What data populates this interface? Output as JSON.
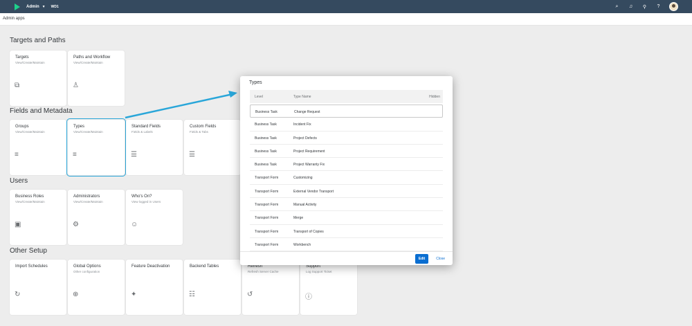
{
  "shell": {
    "app_name": "Admin",
    "system": "WD1",
    "icons": [
      "search-icon",
      "bell-icon",
      "filter-icon",
      "help-icon"
    ]
  },
  "subbar": {
    "label": "Admin apps"
  },
  "sections": {
    "targets": "Targets and Paths",
    "fields": "Fields and Metadata",
    "users": "Users",
    "other": "Other Setup"
  },
  "tiles": {
    "targets": {
      "title": "Targets",
      "sub": "View/Create/Maintain"
    },
    "paths": {
      "title": "Paths and Workflow",
      "sub": "View/Create/Maintain"
    },
    "groups": {
      "title": "Groups",
      "sub": "View/Create/Maintain"
    },
    "types": {
      "title": "Types",
      "sub": "View/Create/Maintain"
    },
    "standard_fields": {
      "title": "Standard Fields",
      "sub": "Fields & Labels"
    },
    "custom_fields": {
      "title": "Custom Fields",
      "sub": "Fields & Tabs"
    },
    "business_roles": {
      "title": "Business Roles",
      "sub": "View/Create/Maintain"
    },
    "administrators": {
      "title": "Administrators",
      "sub": "View/Create/Maintain"
    },
    "whos_on": {
      "title": "Who's On?",
      "sub": "View logged in Users"
    },
    "import_schedules": {
      "title": "Import Schedules",
      "sub": ""
    },
    "global_options": {
      "title": "Global Options",
      "sub": "Other configuration"
    },
    "feature_deactivation": {
      "title": "Feature Deactivation",
      "sub": ""
    },
    "backend_tables": {
      "title": "Backend Tables",
      "sub": ""
    },
    "refresh": {
      "title": "Refresh",
      "sub": "Refresh Server Cache"
    },
    "support": {
      "title": "Support",
      "sub": "Log Support Ticket"
    }
  },
  "dialog": {
    "title": "Types",
    "columns": {
      "level": "Level",
      "type_name": "Type Name",
      "hidden": "Hidden"
    },
    "rows": [
      {
        "level": "Business Task",
        "name": "Change Request"
      },
      {
        "level": "Business Task",
        "name": "Incident Fix"
      },
      {
        "level": "Business Task",
        "name": "Project Defects"
      },
      {
        "level": "Business Task",
        "name": "Project Requirement"
      },
      {
        "level": "Business Task",
        "name": "Project Warranty Fix"
      },
      {
        "level": "Transport Form",
        "name": "Customizing"
      },
      {
        "level": "Transport Form",
        "name": "External Vendor Transport"
      },
      {
        "level": "Transport Form",
        "name": "Manual Activity"
      },
      {
        "level": "Transport Form",
        "name": "Merge"
      },
      {
        "level": "Transport Form",
        "name": "Transport of Copies"
      },
      {
        "level": "Transport Form",
        "name": "Workbench"
      }
    ],
    "edit_label": "Edit",
    "close_label": "Close"
  },
  "colors": {
    "shell": "#354a5f",
    "accent": "#0a6ed1",
    "highlight": "#29a6d9",
    "logo": "#1ed28c"
  }
}
